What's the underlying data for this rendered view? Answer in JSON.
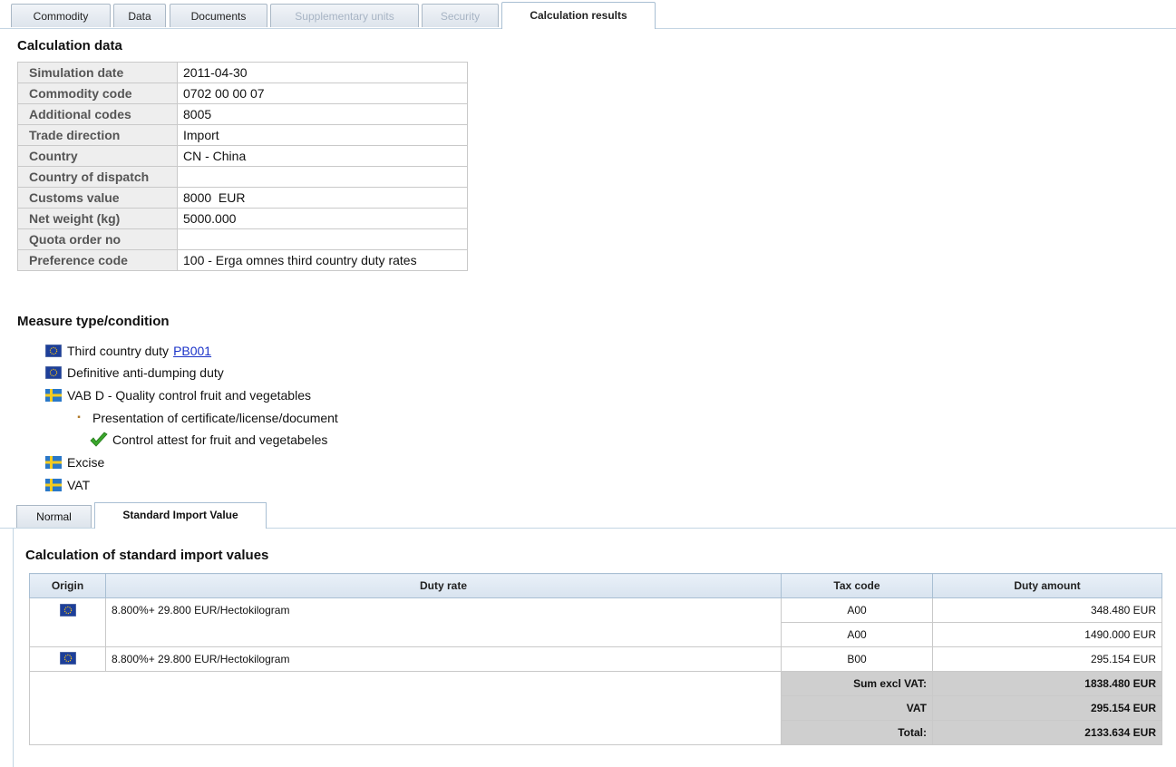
{
  "tabs": [
    {
      "label": "Commodity",
      "state": "normal"
    },
    {
      "label": "Data",
      "state": "normal"
    },
    {
      "label": "Documents",
      "state": "normal"
    },
    {
      "label": "Supplementary units",
      "state": "disabled"
    },
    {
      "label": "Security",
      "state": "disabled"
    },
    {
      "label": "Calculation results",
      "state": "active"
    }
  ],
  "calculation_data": {
    "heading": "Calculation data",
    "rows": [
      {
        "key": "Simulation date",
        "value": "2011-04-30"
      },
      {
        "key": "Commodity code",
        "value": "0702 00 00 07"
      },
      {
        "key": "Additional codes",
        "value": "8005"
      },
      {
        "key": "Trade direction",
        "value": "Import"
      },
      {
        "key": "Country",
        "value": "CN - China"
      },
      {
        "key": "Country of dispatch",
        "value": ""
      },
      {
        "key": "Customs value",
        "value": "8000  EUR"
      },
      {
        "key": "Net weight (kg)",
        "value": "5000.000"
      },
      {
        "key": "Quota order no",
        "value": ""
      },
      {
        "key": "Preference code",
        "value": "100 - Erga omnes third country duty rates"
      }
    ]
  },
  "measures": {
    "heading": "Measure type/condition",
    "items": [
      {
        "flag": "eu-flag-icon",
        "label": "Third country duty",
        "link": "PB001"
      },
      {
        "flag": "eu-flag-icon",
        "label": "Definitive anti-dumping duty"
      },
      {
        "flag": "sweden-flag-icon",
        "label": "VAB D - Quality control fruit and vegetables"
      },
      {
        "flag": "bullet-icon",
        "label": "Presentation of certificate/license/document"
      },
      {
        "flag": "checkmark-icon",
        "label": "Control attest for fruit and vegetabeles"
      },
      {
        "flag": "sweden-flag-icon",
        "label": "Excise"
      },
      {
        "flag": "sweden-flag-icon",
        "label": "VAT"
      }
    ]
  },
  "subtabs": [
    {
      "label": "Normal",
      "state": "normal"
    },
    {
      "label": "Standard Import Value",
      "state": "active"
    }
  ],
  "results": {
    "heading": "Calculation of standard import values",
    "columns": [
      "Origin",
      "Duty rate",
      "Tax code",
      "Duty amount"
    ],
    "rows": [
      {
        "origin": "eu-flag-icon",
        "rate": "8.800%+ 29.800 EUR/Hectokilogram",
        "tax_code": "A00",
        "amount": "348.480 EUR"
      },
      {
        "origin": "",
        "rate": "",
        "tax_code": "A00",
        "amount": "1490.000 EUR"
      },
      {
        "origin": "eu-flag-icon",
        "rate": "8.800%+ 29.800 EUR/Hectokilogram",
        "tax_code": "B00",
        "amount": "295.154 EUR"
      }
    ],
    "totals": [
      {
        "label": "Sum excl VAT:",
        "value": "1838.480 EUR"
      },
      {
        "label": "VAT",
        "value": "295.154 EUR"
      },
      {
        "label": "Total:",
        "value": "2133.634 EUR"
      }
    ]
  },
  "colors": {
    "eu_blue": "#1d3f9a",
    "eu_star": "#f2c21a",
    "se_blue": "#2a78c8",
    "se_yellow": "#f4cb1f",
    "check_green": "#3aa62c",
    "link": "#1a32c8"
  }
}
